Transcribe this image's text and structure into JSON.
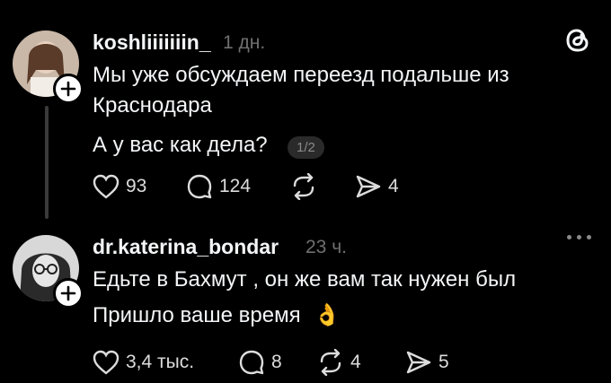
{
  "posts": [
    {
      "username": "koshliiiiiiin_",
      "time": "1 дн.",
      "lines": [
        "Мы уже обсуждаем переезд подальше из",
        "Краснодара"
      ],
      "second_text": "А у вас как дела?",
      "page_badge": "1/2",
      "likes": "93",
      "replies": "124",
      "reposts": "",
      "shares": "4"
    },
    {
      "username": "dr.katerina_bondar",
      "time": "23 ч.",
      "lines": [
        "Едьте в Бахмут , он же вам так нужен был",
        "Пришло ваше время"
      ],
      "emoji": "👌",
      "likes": "3,4 тыс.",
      "replies": "8",
      "reposts": "4",
      "shares": "5"
    }
  ],
  "icons": {
    "logo": "threads-logo-icon",
    "like": "heart-icon",
    "reply": "comment-icon",
    "repost": "repost-icon",
    "share": "send-icon",
    "follow": "plus-icon",
    "more": "more-dots-icon"
  },
  "colors": {
    "background": "#000000",
    "text": "#f3f5f7",
    "muted": "#6f6f6f"
  }
}
